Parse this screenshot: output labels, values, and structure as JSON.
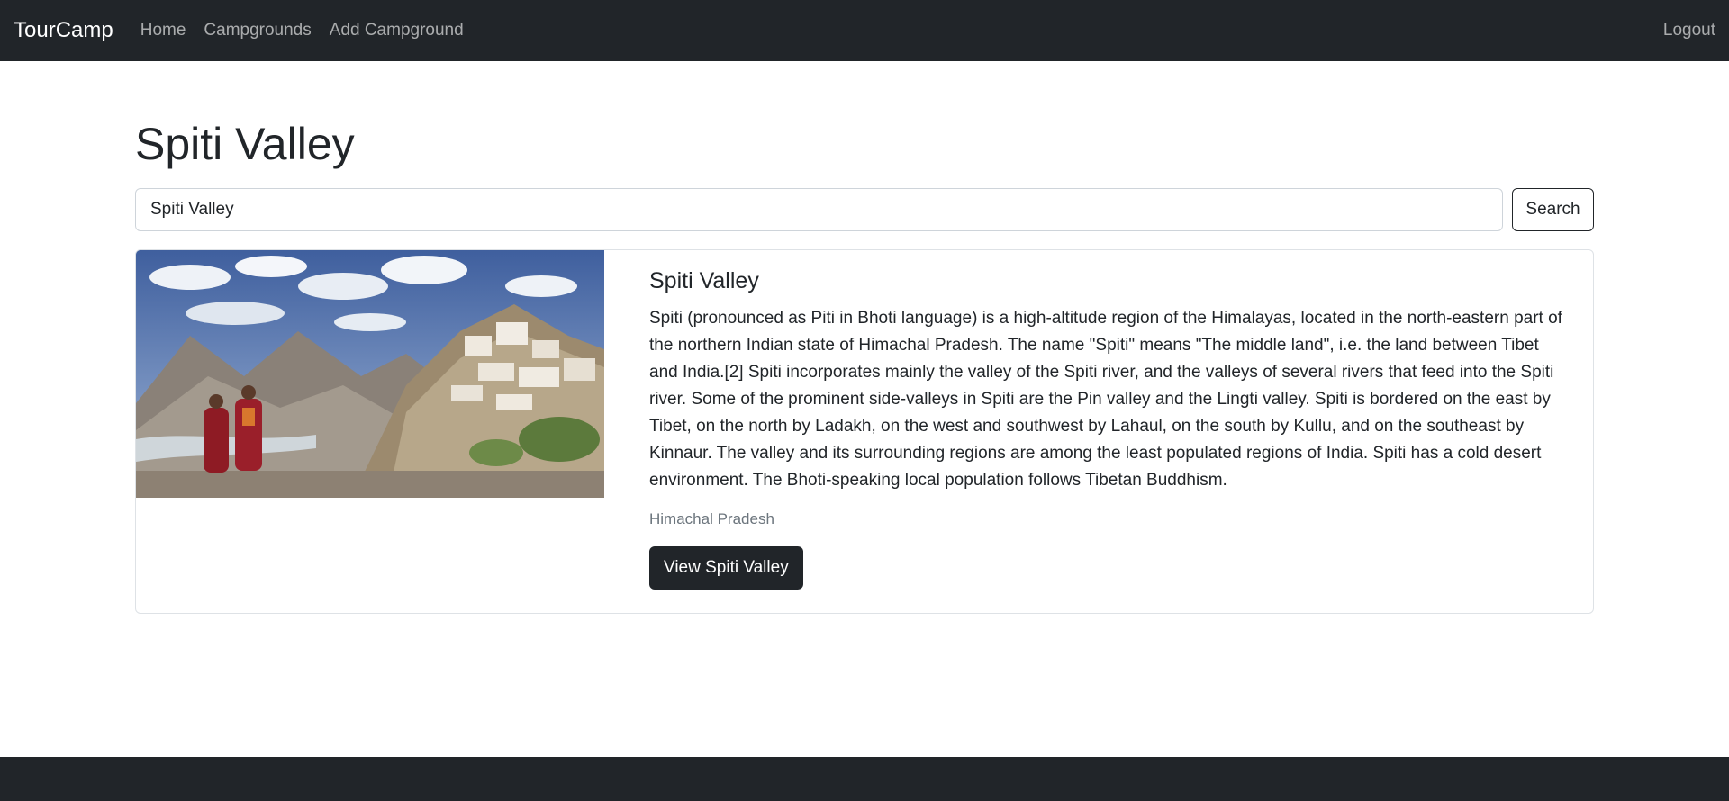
{
  "navbar": {
    "brand": "TourCamp",
    "links": [
      {
        "label": "Home"
      },
      {
        "label": "Campgrounds"
      },
      {
        "label": "Add Campground"
      }
    ],
    "logout_label": "Logout"
  },
  "page": {
    "title": "Spiti Valley"
  },
  "search": {
    "value": "Spiti Valley",
    "button_label": "Search"
  },
  "results": [
    {
      "title": "Spiti Valley",
      "description": "Spiti (pronounced as Piti in Bhoti language) is a high-altitude region of the Himalayas, located in the north-eastern part of the northern Indian state of Himachal Pradesh. The name \"Spiti\" means \"The middle land\", i.e. the land between Tibet and India.[2] Spiti incorporates mainly the valley of the Spiti river, and the valleys of several rivers that feed into the Spiti river. Some of the prominent side-valleys in Spiti are the Pin valley and the Lingti valley. Spiti is bordered on the east by Tibet, on the north by Ladakh, on the west and southwest by Lahaul, on the south by Kullu, and on the southeast by Kinnaur. The valley and its surrounding regions are among the least populated regions of India. Spiti has a cold desert environment. The Bhoti-speaking local population follows Tibetan Buddhism.",
      "location": "Himachal Pradesh",
      "button_label": "View Spiti Valley"
    }
  ],
  "colors": {
    "navbar_bg": "#212529",
    "button_dark": "#212529",
    "muted_text": "#6c757d"
  }
}
